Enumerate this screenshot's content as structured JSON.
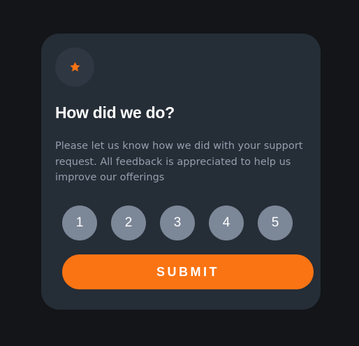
{
  "card": {
    "icon": "star-icon",
    "title": "How did we do?",
    "description": "Please let us know how we did with your support request. All feedback is appreciated to help us improve our offerings",
    "ratings": [
      "1",
      "2",
      "3",
      "4",
      "5"
    ],
    "submit_label": "SUBMIT"
  },
  "colors": {
    "page_background": "#131518",
    "card_background": "#252d37",
    "accent": "#fb7413",
    "rating_button": "#7c8798",
    "text_muted": "#969fad"
  }
}
